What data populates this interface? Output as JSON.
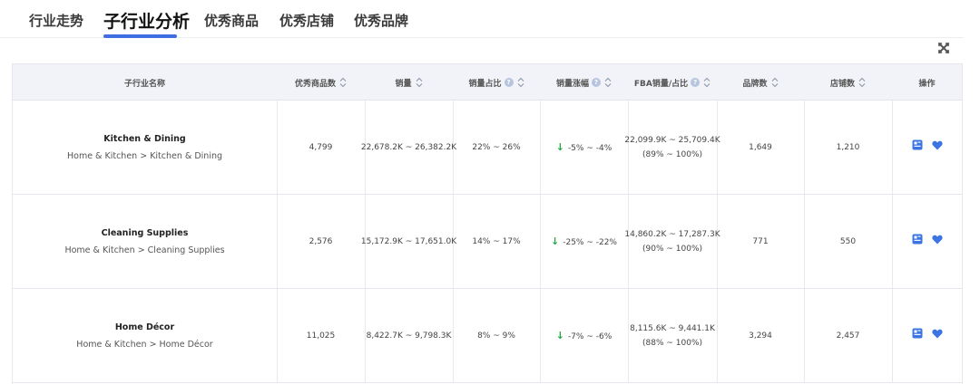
{
  "tabs": [
    "行业走势",
    "子行业分析",
    "优秀商品",
    "优秀店铺",
    "优秀品牌"
  ],
  "active_tab": 1,
  "table": {
    "columns": [
      {
        "label": "子行业名称",
        "sortable": false,
        "info": false
      },
      {
        "label": "优秀商品数",
        "sortable": true,
        "info": false
      },
      {
        "label": "销量",
        "sortable": true,
        "info": false
      },
      {
        "label": "销量占比",
        "sortable": true,
        "info": true
      },
      {
        "label": "销量涨幅",
        "sortable": true,
        "info": true
      },
      {
        "label": "FBA销量/占比",
        "sortable": true,
        "info": true
      },
      {
        "label": "品牌数",
        "sortable": true,
        "info": false
      },
      {
        "label": "店铺数",
        "sortable": true,
        "info": false
      },
      {
        "label": "操作",
        "sortable": false,
        "info": false
      }
    ],
    "rows": [
      {
        "name": "Kitchen & Dining",
        "path": "Home & Kitchen > Kitchen & Dining",
        "products": "4,799",
        "sales": "22,678.2K ~ 26,382.2K",
        "share": "22% ~ 26%",
        "growth": "-5% ~ -4%",
        "fba_sales": "22,099.9K ~ 25,709.4K",
        "fba_share": "(89% ~ 100%)",
        "brands": "1,649",
        "stores": "1,210"
      },
      {
        "name": "Cleaning Supplies",
        "path": "Home & Kitchen > Cleaning Supplies",
        "products": "2,576",
        "sales": "15,172.9K ~ 17,651.0K",
        "share": "14% ~ 17%",
        "growth": "-25% ~ -22%",
        "fba_sales": "14,860.2K ~ 17,287.3K",
        "fba_share": "(90% ~ 100%)",
        "brands": "771",
        "stores": "550"
      },
      {
        "name": "Home Décor",
        "path": "Home & Kitchen > Home Décor",
        "products": "11,025",
        "sales": "8,422.7K ~ 9,798.3K",
        "share": "8% ~ 9%",
        "growth": "-7% ~ -6%",
        "fba_sales": "8,115.6K ~ 9,441.1K",
        "fba_share": "(88% ~ 100%)",
        "brands": "3,294",
        "stores": "2,457"
      }
    ]
  },
  "icons": {
    "close": "close-icon",
    "detail": "detail-icon",
    "favorite": "heart-icon",
    "info": "info-icon",
    "sort": "sort-icon",
    "trend_down": "arrow-down-icon"
  },
  "info_glyph": "?",
  "down_arrow_glyph": "↓",
  "colors": {
    "accent": "#3d6fe0",
    "header_bg": "#f1f3f8",
    "down": "#22a84a",
    "action_icon": "#3d74e4"
  }
}
